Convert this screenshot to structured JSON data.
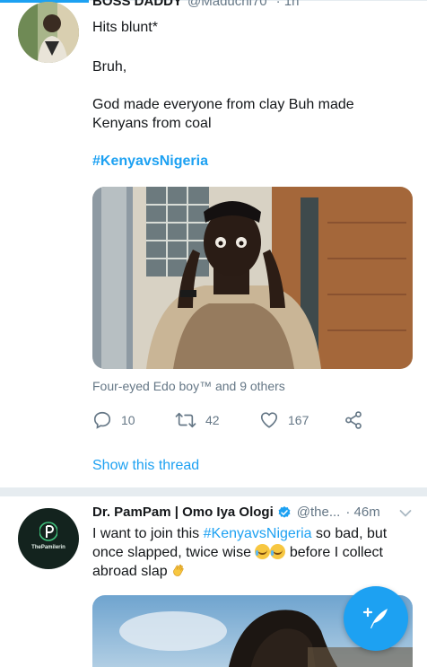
{
  "tweet1": {
    "display_name": "BOSS DADDY",
    "handle": "@Maduchi70",
    "time": "· 1h",
    "text_line1": "Hits blunt*",
    "text_line2": "Bruh,",
    "text_line3": "God made everyone from clay Buh made Kenyans from coal",
    "hashtag": "#KenyavsNigeria",
    "liked_by": "Four-eyed Edo boy™ and 9 others",
    "reply_count": "10",
    "retweet_count": "42",
    "like_count": "167",
    "show_thread": "Show this thread"
  },
  "tweet2": {
    "display_name": "Dr. PamPam | Omo Iya Ologi",
    "handle": "@the...",
    "time": "· 46m",
    "text_before_hashtag": "I want to join this ",
    "hashtag": "#KenyavsNigeria",
    "text_after_hashtag": " so bad, but once slapped, twice wise ",
    "text_after_emoji": " before I collect abroad slap ",
    "avatar_brand": "ThePamilerin"
  },
  "icons": {
    "reply": "reply-icon",
    "retweet": "retweet-icon",
    "like": "heart-icon",
    "share": "share-icon",
    "verified": "verified-badge-icon",
    "chevron": "chevron-down-icon",
    "compose": "compose-tweet-icon"
  },
  "colors": {
    "accent": "#1da1f2",
    "secondary_text": "#657786",
    "primary_text": "#14171a",
    "divider": "#e6ecf0"
  }
}
